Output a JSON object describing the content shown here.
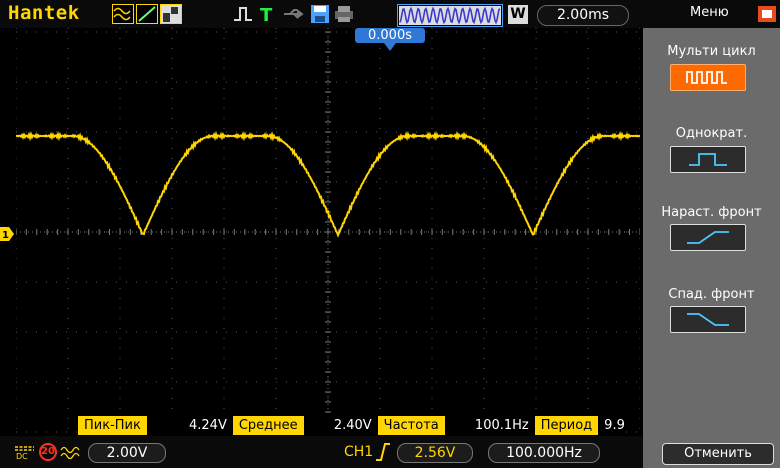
{
  "topbar": {
    "brand": "Hantek",
    "timebase": "2.00ms",
    "timebase_mode": "W",
    "menu_label": "Меню"
  },
  "screen": {
    "trigger_position": "0.000s",
    "channel_marker": "1",
    "trace_color": "#ffd600",
    "grid_color": "#555555"
  },
  "side_menu": {
    "title": "Мульти цикл",
    "items": [
      {
        "label": "Однократ.",
        "icon": "single-pulse-icon"
      },
      {
        "label": "Нараст. фронт",
        "icon": "rising-edge-icon"
      },
      {
        "label": "Спад. фронт",
        "icon": "falling-edge-icon"
      }
    ],
    "active_icon": "multi-pulse-icon",
    "cancel_label": "Отменить"
  },
  "measurements": [
    {
      "label": "Пик-Пик",
      "value": "4.24V"
    },
    {
      "label": "Среднее",
      "value": "2.40V"
    },
    {
      "label": "Частота",
      "value": "100.1Hz"
    },
    {
      "label": "Период",
      "value": "9.9"
    }
  ],
  "bottombar": {
    "coupling_icon": "dc-icon",
    "bw_limit_label": "20",
    "volts_div": "2.00V",
    "trigger_source": "CH1",
    "trigger_level": "2.56V",
    "trigger_frequency": "100.000Hz"
  },
  "colors": {
    "accent": "#ffd600",
    "menu_bg": "#6b6b6b",
    "active_button": "#ff6a00",
    "trigger_marker": "#2f78d6"
  }
}
